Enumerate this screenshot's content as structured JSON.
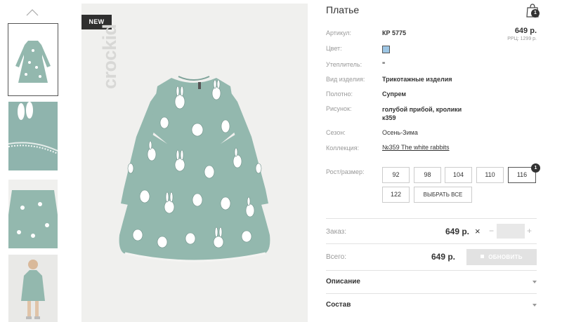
{
  "badge": "NEW",
  "brand": "crockid",
  "product": {
    "title": "Платье",
    "cart_count": "1",
    "price": "649 р.",
    "rrp": "РРЦ: 1299 р.",
    "fields": {
      "article_label": "Артикул:",
      "article_value": "КР 5775",
      "color_label": "Цвет:",
      "color_hex": "#9dc6e4",
      "insulation_label": "Утеплитель:",
      "insulation_value": "\"",
      "type_label": "Вид изделия:",
      "type_value": "Трикотажные изделия",
      "fabric_label": "Полотно:",
      "fabric_value": "Супрем",
      "pattern_label": "Рисунок:",
      "pattern_value_line1": "голубой прибой, кролики",
      "pattern_value_line2": "к359",
      "season_label": "Сезон:",
      "season_value": "Осень-Зима",
      "collection_label": "Коллекция:",
      "collection_value": "№359 The white rabbits"
    },
    "sizes_label": "Рост/размер:",
    "sizes": [
      "92",
      "98",
      "104",
      "110",
      "116",
      "122"
    ],
    "select_all": "ВЫБРАТЬ ВСЕ",
    "selected_size_count": "1",
    "order_label": "Заказ:",
    "order_price": "649 р.",
    "total_label": "Всего:",
    "total_price": "649 р.",
    "update_button": "ОБНОВИТЬ",
    "accordion": [
      "Описание",
      "Состав"
    ]
  },
  "colors": {
    "dress": "#93b8ae",
    "dark": "#333333",
    "muted_label": "#999999",
    "swatch": "#9dc6e4"
  }
}
